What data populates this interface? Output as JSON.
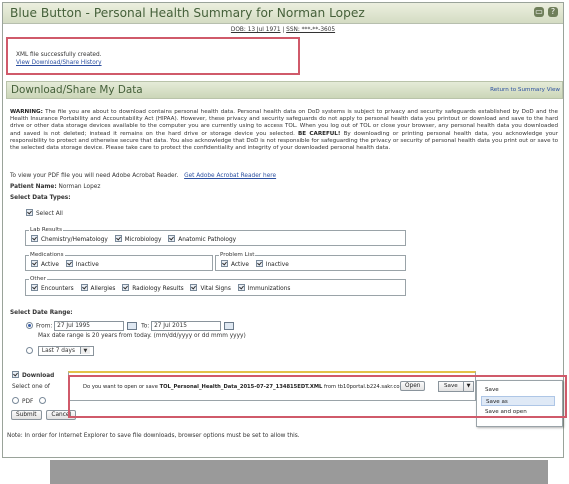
{
  "header": {
    "title": "Blue Button - Personal Health Summary for Norman Lopez",
    "dob_label": "DOB: 13 Jul 1971",
    "ssn_label": "SSN: ***-**-3605",
    "icons": [
      "collapse-icon",
      "help-icon"
    ]
  },
  "notice": {
    "message": "XML file successfully created.",
    "link": "View Download/Share History"
  },
  "section": {
    "title": "Download/Share My Data",
    "return_link": "Return to Summary View"
  },
  "warning": {
    "label": "WARNING:",
    "text1": "The file you are about to download contains personal health data. Personal health data on DoD systems is subject to privacy and security safeguards established by DoD and the Health Insurance Portability and Accountability Act (HIPAA). However, these privacy and security safeguards do not apply to personal health data you printout or download and save to the hard drive or other data storage devices available to the computer you are currently using to access TOL. When you log out of TOL or close your browser, any personal health data you downloaded and saved is not deleted; instead it remains on the hard drive or storage device you selected.",
    "careful": "BE CAREFUL!",
    "text2": "By downloading or printing personal health data, you acknowledge your responsibility to protect and otherwise secure that data. You also acknowledge that DoD is not responsible for safeguarding the privacy or security of personal health data you print out or save to the selected data storage device. Please take care to protect the confidentiality and integrity of your downloaded personal health data."
  },
  "pdf_reader": {
    "text": "To view your PDF file you will need Adobe Acrobat Reader.",
    "link": "Get Adobe Acrobat Reader here"
  },
  "patient": {
    "label": "Patient Name:",
    "name": "Norman Lopez"
  },
  "data_types": {
    "heading": "Select Data Types:",
    "select_all": "Select All",
    "lab_results": {
      "legend": "Lab Results",
      "items": [
        "Chemistry/Hematology",
        "Microbiology",
        "Anatomic Pathology"
      ]
    },
    "medications": {
      "legend": "Medications",
      "items": [
        "Active",
        "Inactive"
      ]
    },
    "problem_list": {
      "legend": "Problem List",
      "items": [
        "Active",
        "Inactive"
      ]
    },
    "other": {
      "legend": "Other",
      "items": [
        "Encounters",
        "Allergies",
        "Radiology Results",
        "Vital Signs",
        "Immunizations"
      ]
    }
  },
  "date_range": {
    "heading": "Select Date Range:",
    "from_label": "From:",
    "from_value": "27 Jul 1995",
    "to_label": "To:",
    "to_value": "27 Jul 2015",
    "hint": "Max date range is 20 years from today. (mm/dd/yyyy or dd mmm yyyy)",
    "preset": "Last 7 days"
  },
  "download": {
    "checkbox_label": "Download",
    "select_one": "Select one of",
    "pdf_label": "PDF"
  },
  "buttons": {
    "submit": "Submit",
    "cancel": "Cancel"
  },
  "download_bar": {
    "prefix": "Do you want to open or save",
    "filename": "TOL_Personal_Health_Data_2015-07-27_134815EDT.XML",
    "suffix": "from tb10portal.b224.sakr.com?",
    "open": "Open",
    "save": "Save"
  },
  "save_menu": {
    "items": [
      "Save",
      "Save as",
      "Save and open"
    ],
    "highlighted": "Save as"
  },
  "note": "Note: In order for Internet Explorer to save file downloads, browser options must be set to allow this."
}
